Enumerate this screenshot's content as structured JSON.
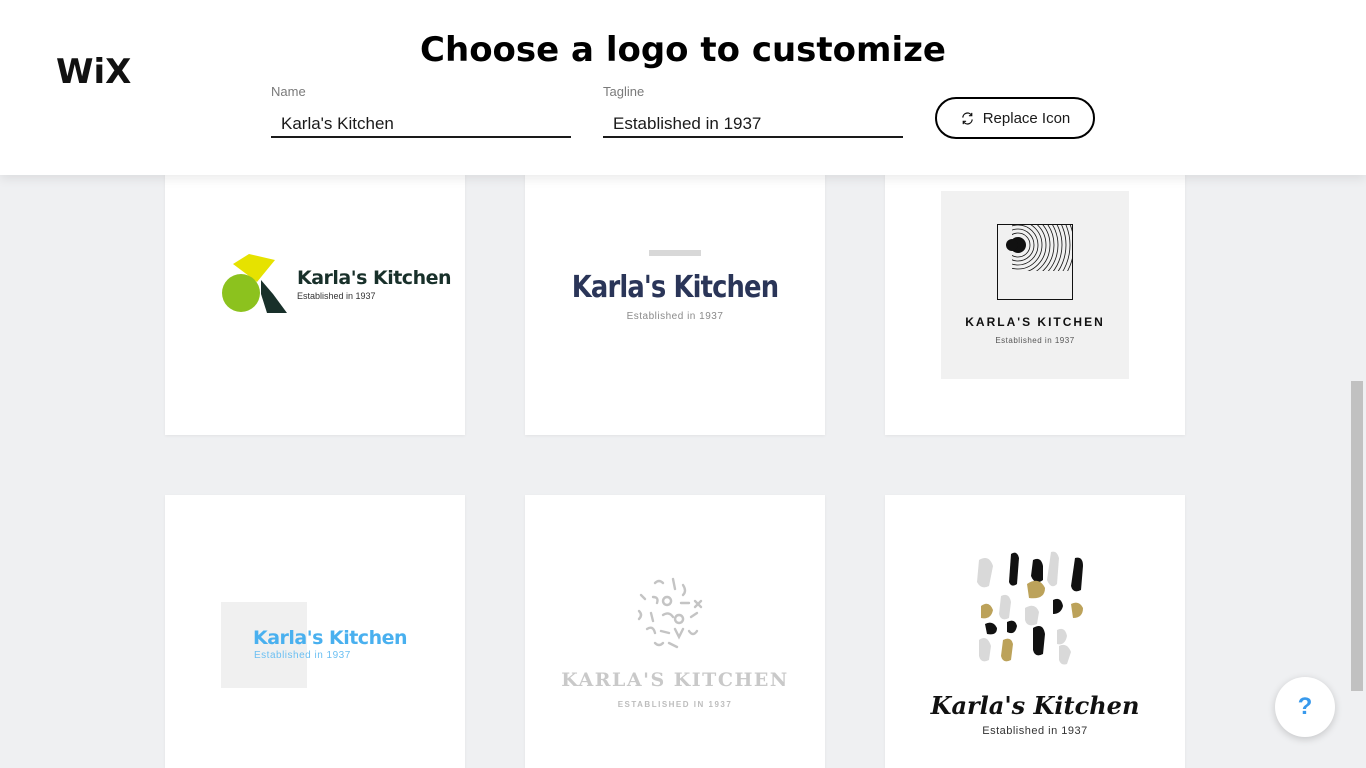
{
  "brand": {
    "logo_text": "WiX"
  },
  "header": {
    "title": "Choose a logo to customize",
    "name_field": {
      "label": "Name",
      "value": "Karla's Kitchen"
    },
    "tagline_field": {
      "label": "Tagline",
      "value": "Established in 1937"
    },
    "replace_icon_label": "Replace Icon"
  },
  "logos": [
    {
      "name": "Karla's Kitchen",
      "tagline": "Established in 1937",
      "name_color": "#18302a"
    },
    {
      "name": "Karla's Kitchen",
      "tagline": "Established in 1937",
      "name_color": "#2a3558"
    },
    {
      "name": "KARLA'S KITCHEN",
      "tagline": "Established in 1937",
      "name_color": "#111111"
    },
    {
      "name": "Karla's Kitchen",
      "tagline": "Established in 1937",
      "name_color": "#49b0ef"
    },
    {
      "name": "KARLA'S KITCHEN",
      "tagline": "ESTABLISHED IN 1937",
      "name_color": "#c9c9c9"
    },
    {
      "name": "Karla's Kitchen",
      "tagline": "Established in 1937",
      "name_color": "#111111"
    }
  ],
  "help": {
    "label": "?"
  },
  "colors": {
    "accent": "#3899ec",
    "background": "#eff0f2"
  }
}
